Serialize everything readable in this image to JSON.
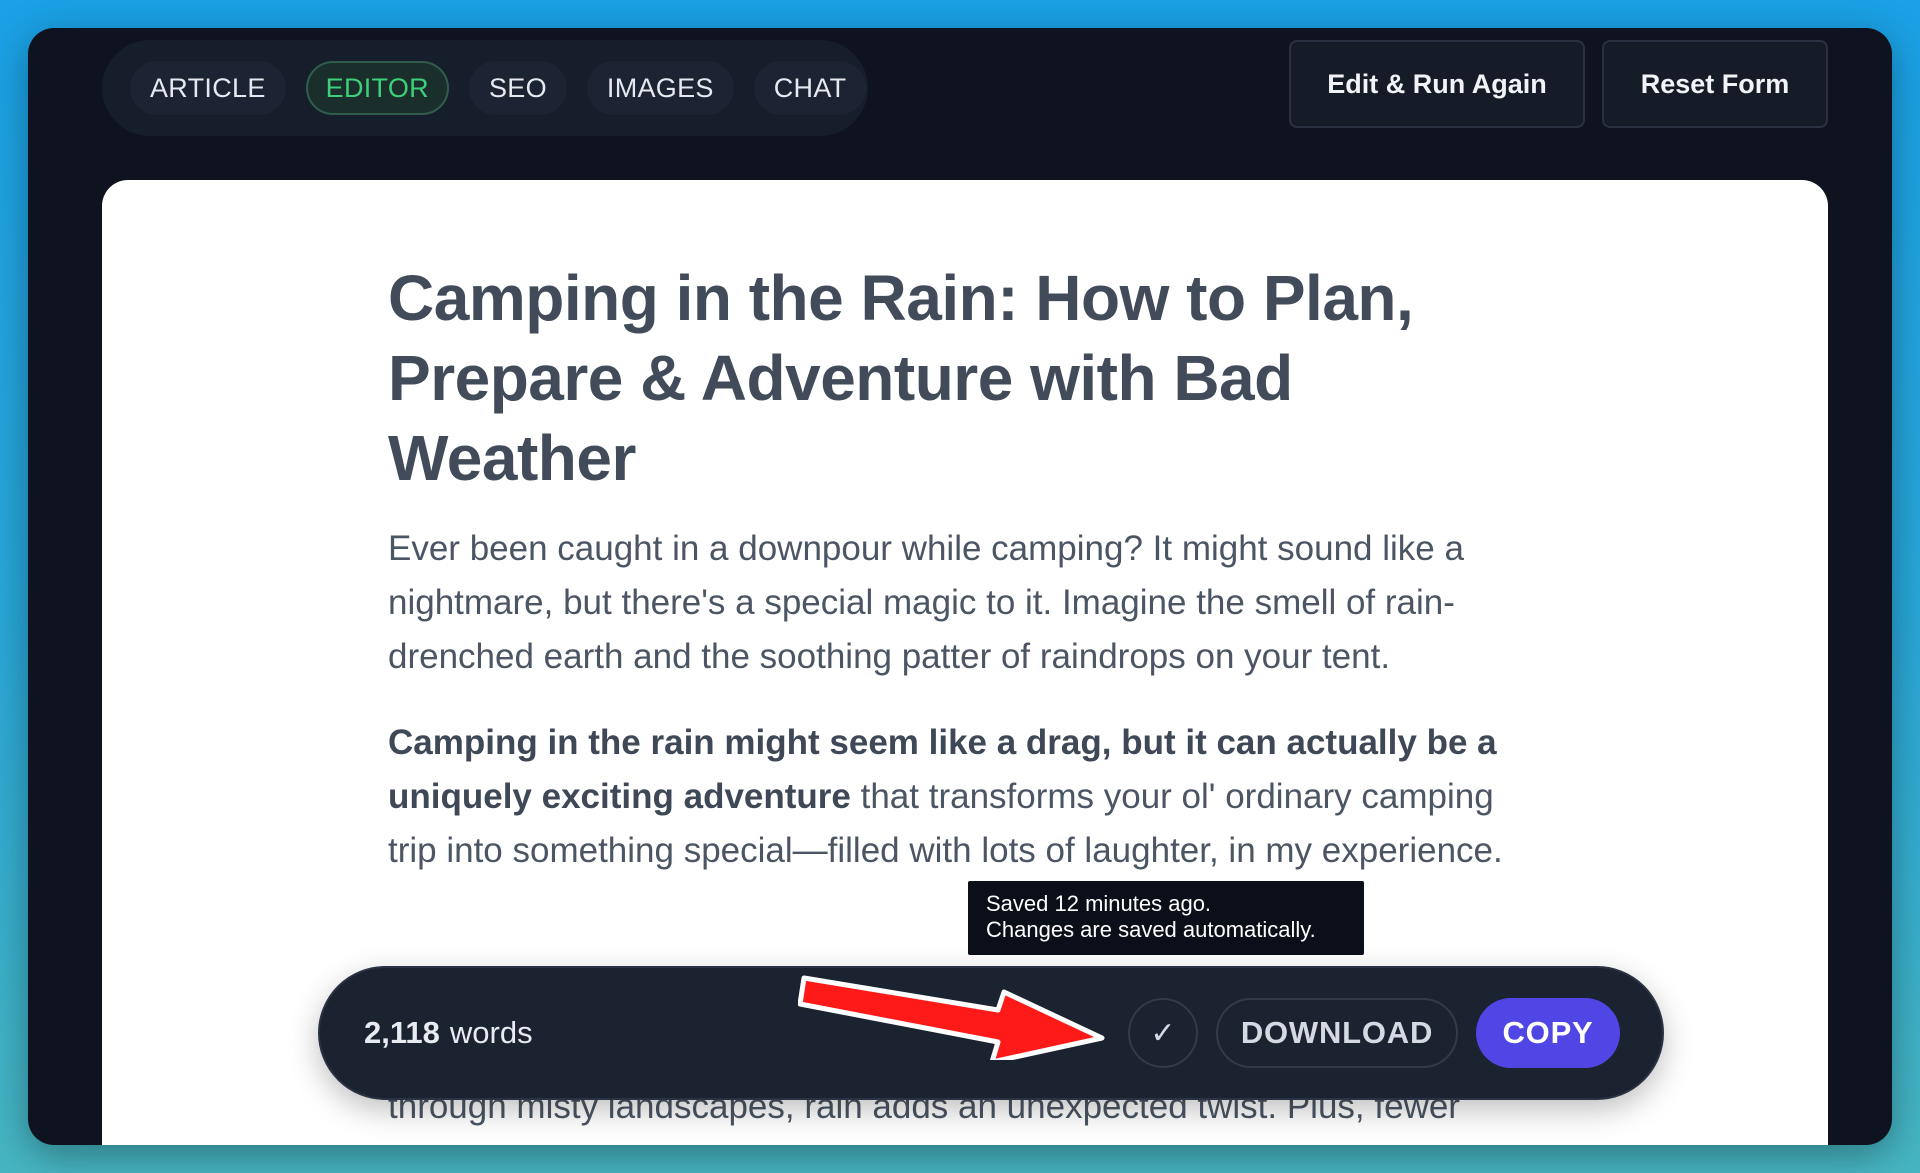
{
  "tabs": [
    {
      "label": "ARTICLE",
      "active": false
    },
    {
      "label": "EDITOR",
      "active": true
    },
    {
      "label": "SEO",
      "active": false
    },
    {
      "label": "IMAGES",
      "active": false
    },
    {
      "label": "CHAT",
      "active": false
    }
  ],
  "toolbar": {
    "edit_run_label": "Edit & Run Again",
    "reset_label": "Reset Form"
  },
  "article": {
    "title": "Camping in the Rain: How to Plan, Prepare & Adventure with Bad Weather",
    "paragraph1": "Ever been caught in a downpour while camping? It might sound like a nightmare, but there's a special magic to it. Imagine the smell of rain-drenched earth and the soothing patter of raindrops on your tent.",
    "paragraph2_bold": "Camping in the rain might seem like a drag, but it can actually be a uniquely exciting adventure",
    "paragraph2_rest": " that transforms your ol' ordinary camping trip into something special—filled with lots of laughter, in my experience.",
    "paragraph3_visible": "through misty landscapes, rain adds an unexpected twist. Plus, fewer people at the campsite mean more solitude and peace. So, grab your"
  },
  "bottom_bar": {
    "word_count": "2,118",
    "words_label": "words",
    "check_icon": "✓",
    "download_label": "DOWNLOAD",
    "copy_label": "COPY"
  },
  "tooltip": {
    "line1": "Saved 12 minutes ago.",
    "line2": "Changes are saved automatically."
  },
  "colors": {
    "active_tab": "#3ecf7a",
    "copy_button": "#4f46e5",
    "annotation_arrow": "#ff1a1a"
  }
}
